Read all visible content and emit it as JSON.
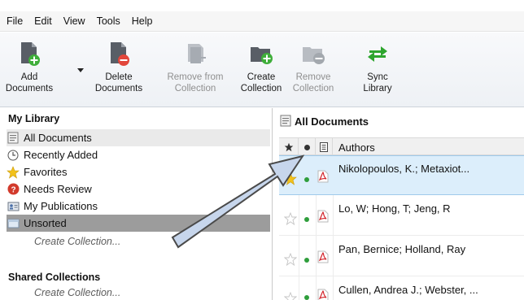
{
  "menu": [
    "File",
    "Edit",
    "View",
    "Tools",
    "Help"
  ],
  "toolbar": {
    "add_documents": {
      "line1": "Add",
      "line2": "Documents"
    },
    "delete_documents": {
      "line1": "Delete",
      "line2": "Documents"
    },
    "remove_from_collection": {
      "line1": "Remove from",
      "line2": "Collection"
    },
    "create_collection": {
      "line1": "Create",
      "line2": "Collection"
    },
    "remove_collection": {
      "line1": "Remove",
      "line2": "Collection"
    },
    "sync_library": {
      "line1": "Sync",
      "line2": "Library"
    }
  },
  "library": {
    "heading": "My Library",
    "items": [
      {
        "label": "All Documents",
        "icon": "all-documents-icon"
      },
      {
        "label": "Recently Added",
        "icon": "clock-icon"
      },
      {
        "label": "Favorites",
        "icon": "star-icon"
      },
      {
        "label": "Needs Review",
        "icon": "review-icon"
      },
      {
        "label": "My Publications",
        "icon": "publications-icon"
      },
      {
        "label": "Unsorted",
        "icon": "unsorted-icon"
      }
    ],
    "create_collection": "Create Collection...",
    "shared_heading": "Shared Collections",
    "shared_create_collection": "Create Collection..."
  },
  "documents": {
    "title": "All Documents",
    "column_authors": "Authors",
    "rows": [
      {
        "authors": "Nikolopoulos, K.; Metaxiot...",
        "favorite": true,
        "read": true,
        "selected": true
      },
      {
        "authors": "Lo, W; Hong, T; Jeng, R",
        "favorite": false,
        "read": true,
        "selected": false
      },
      {
        "authors": "Pan, Bernice; Holland, Ray",
        "favorite": false,
        "read": true,
        "selected": false
      },
      {
        "authors": "Cullen, Andrea J.; Webster, ...",
        "favorite": false,
        "read": true,
        "selected": false
      }
    ]
  },
  "colors": {
    "accent_selected_row": "#dceefb",
    "read_dot": "#2f9e3c",
    "sync_green": "#2ea52e",
    "arrow_fill": "#c7d6ec"
  }
}
